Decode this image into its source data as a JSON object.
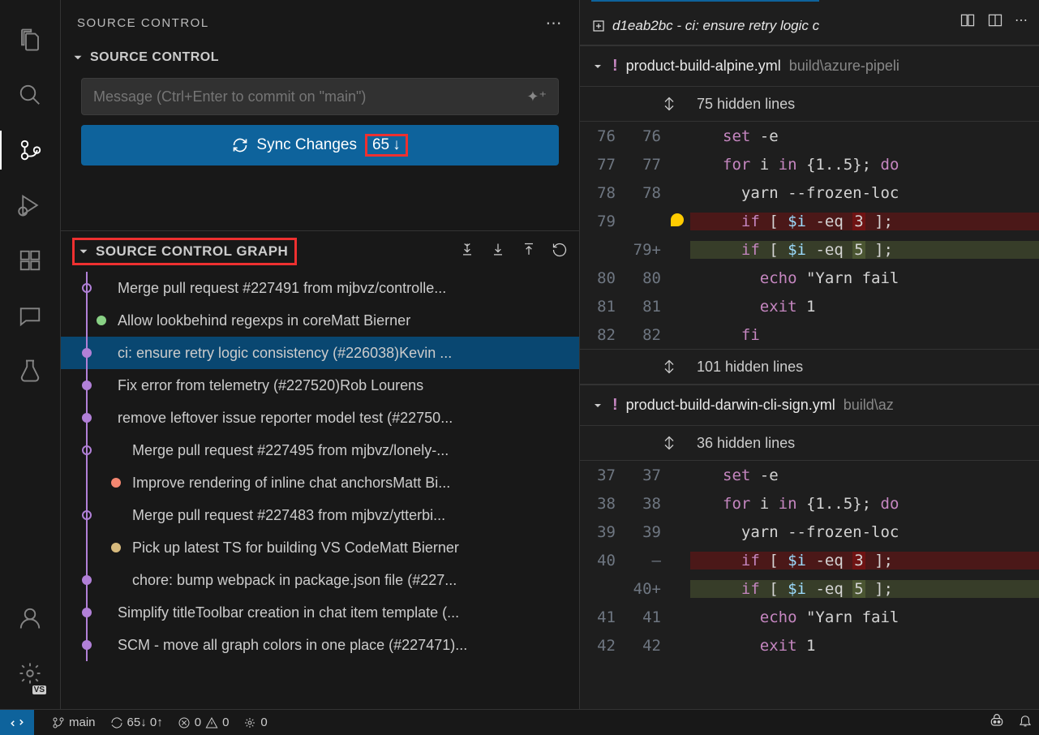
{
  "sidebar": {
    "title": "SOURCE CONTROL",
    "section_title": "SOURCE CONTROL",
    "message_placeholder": "Message (Ctrl+Enter to commit on \"main\")",
    "sync_label": "Sync Changes",
    "sync_count": "65",
    "graph_title": "SOURCE CONTROL GRAPH",
    "commits": [
      {
        "subject": "Merge pull request #227491 from mjbvz/controlle...",
        "author": "",
        "selected": false,
        "col": 1,
        "fill": "hollow"
      },
      {
        "subject": "Allow lookbehind regexps in core",
        "author": "Matt Bierner",
        "selected": false,
        "col": 2,
        "fill": "green"
      },
      {
        "subject": "ci: ensure retry logic consistency (#226038)",
        "author": "Kevin ...",
        "selected": true,
        "col": 1,
        "fill": "purple"
      },
      {
        "subject": "Fix error from telemetry (#227520)",
        "author": "Rob Lourens",
        "selected": false,
        "col": 1,
        "fill": "purple"
      },
      {
        "subject": "remove leftover issue reporter model test (#22750...",
        "author": "",
        "selected": false,
        "col": 1,
        "fill": "purple"
      },
      {
        "subject": "Merge pull request #227495 from mjbvz/lonely-...",
        "author": "",
        "selected": false,
        "col": 1,
        "fill": "hollow",
        "wide": true
      },
      {
        "subject": "Improve rendering of inline chat anchors",
        "author": "Matt Bi...",
        "selected": false,
        "col": 3,
        "fill": "red",
        "wide": true
      },
      {
        "subject": "Merge pull request #227483 from mjbvz/ytterbi...",
        "author": "",
        "selected": false,
        "col": 1,
        "fill": "hollow",
        "wide": true
      },
      {
        "subject": "Pick up latest TS for building VS Code",
        "author": "Matt Bierner",
        "selected": false,
        "col": 3,
        "fill": "yellow",
        "wide": true
      },
      {
        "subject": "chore: bump webpack in package.json file (#227...",
        "author": "",
        "selected": false,
        "col": 1,
        "fill": "purple",
        "wide": true
      },
      {
        "subject": "Simplify titleToolbar creation in chat item template (...",
        "author": "",
        "selected": false,
        "col": 1,
        "fill": "purple"
      },
      {
        "subject": "SCM - move all graph colors in one place (#227471)...",
        "author": "",
        "selected": false,
        "col": 1,
        "fill": "purple"
      }
    ]
  },
  "editor": {
    "tab_title": "d1eab2bc - ci: ensure retry logic c",
    "files": [
      {
        "name": "product-build-alpine.yml",
        "path": "build\\azure-pipeli",
        "hidden_top": "75 hidden lines",
        "hidden_bottom": "101 hidden lines",
        "lines": [
          {
            "l": "76",
            "r": "76",
            "code": "set -e"
          },
          {
            "l": "77",
            "r": "77",
            "code": "for i in {1..5}; do"
          },
          {
            "l": "78",
            "r": "78",
            "code": "  yarn --frozen-loc"
          },
          {
            "l": "79",
            "r": "",
            "code": "  if [ $i -eq 3 ];",
            "type": "del",
            "bulb": true,
            "hi": "3"
          },
          {
            "l": "",
            "r": "79+",
            "code": "  if [ $i -eq 5 ];",
            "type": "add",
            "hi": "5"
          },
          {
            "l": "80",
            "r": "80",
            "code": "    echo \"Yarn fail"
          },
          {
            "l": "81",
            "r": "81",
            "code": "    exit 1"
          },
          {
            "l": "82",
            "r": "82",
            "code": "  fi"
          }
        ]
      },
      {
        "name": "product-build-darwin-cli-sign.yml",
        "path": "build\\az",
        "hidden_top": "36 hidden lines",
        "lines": [
          {
            "l": "37",
            "r": "37",
            "code": "set -e"
          },
          {
            "l": "38",
            "r": "38",
            "code": "for i in {1..5}; do"
          },
          {
            "l": "39",
            "r": "39",
            "code": "  yarn --frozen-loc"
          },
          {
            "l": "40",
            "r": "—",
            "code": "  if [ $i -eq 3 ];",
            "type": "del",
            "hi": "3"
          },
          {
            "l": "",
            "r": "40+",
            "code": "  if [ $i -eq 5 ];",
            "type": "add",
            "hi": "5"
          },
          {
            "l": "41",
            "r": "41",
            "code": "    echo \"Yarn fail"
          },
          {
            "l": "42",
            "r": "42",
            "code": "    exit 1"
          }
        ]
      }
    ]
  },
  "statusbar": {
    "branch": "main",
    "sync": "65↓ 0↑",
    "errors": "0",
    "warnings": "0",
    "ports": "0"
  }
}
